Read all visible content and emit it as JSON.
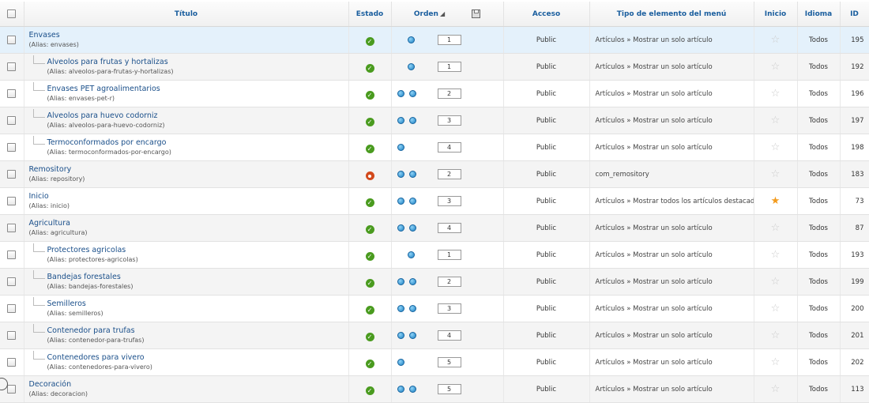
{
  "header": {
    "title": "Título",
    "estado": "Estado",
    "orden": "Orden",
    "acceso": "Acceso",
    "tipo": "Tipo de elemento del menú",
    "inicio": "Inicio",
    "idioma": "Idioma",
    "id": "ID"
  },
  "alias_prefix": "(Alias:",
  "colors": {
    "link": "#1a4f8a",
    "header_text": "#1a5e9e",
    "status_published": "#4a9b1f",
    "status_unpublished": "#d2491c",
    "home_star": "#f39a1c",
    "active_row": "#e4f1fb"
  },
  "rows": [
    {
      "title": "Envases",
      "alias": "(Alias: envases)",
      "level": 1,
      "status": "published",
      "arrows": "down",
      "order": "1",
      "access": "Public",
      "type": "Artículos » Mostrar un solo artículo",
      "home": false,
      "lang": "Todos",
      "id": "195"
    },
    {
      "title": "Alveolos para frutas y hortalizas",
      "alias": "(Alias: alveolos-para-frutas-y-hortalizas)",
      "level": 2,
      "status": "published",
      "arrows": "down",
      "order": "1",
      "access": "Public",
      "type": "Artículos » Mostrar un solo artículo",
      "home": false,
      "lang": "Todos",
      "id": "192"
    },
    {
      "title": "Envases PET agroalimentarios",
      "alias": "(Alias: envases-pet-r)",
      "level": 2,
      "status": "published",
      "arrows": "both",
      "order": "2",
      "access": "Public",
      "type": "Artículos » Mostrar un solo artículo",
      "home": false,
      "lang": "Todos",
      "id": "196"
    },
    {
      "title": "Alveolos para huevo codorniz",
      "alias": "(Alias: alveolos-para-huevo-codorniz)",
      "level": 2,
      "status": "published",
      "arrows": "both",
      "order": "3",
      "access": "Public",
      "type": "Artículos » Mostrar un solo artículo",
      "home": false,
      "lang": "Todos",
      "id": "197"
    },
    {
      "title": "Termoconformados por encargo",
      "alias": "(Alias: termoconformados-por-encargo)",
      "level": 2,
      "status": "published",
      "arrows": "up",
      "order": "4",
      "access": "Public",
      "type": "Artículos » Mostrar un solo artículo",
      "home": false,
      "lang": "Todos",
      "id": "198"
    },
    {
      "title": "Remository",
      "alias": "(Alias: repository)",
      "level": 1,
      "status": "unpublished",
      "arrows": "both",
      "order": "2",
      "access": "Public",
      "type": "com_remository",
      "home": false,
      "lang": "Todos",
      "id": "183"
    },
    {
      "title": "Inicio",
      "alias": "(Alias: inicio)",
      "level": 1,
      "status": "published",
      "arrows": "both",
      "order": "3",
      "access": "Public",
      "type": "Artículos » Mostrar todos los artículos destacados",
      "home": true,
      "lang": "Todos",
      "id": "73"
    },
    {
      "title": "Agricultura",
      "alias": "(Alias: agricultura)",
      "level": 1,
      "status": "published",
      "arrows": "both",
      "order": "4",
      "access": "Public",
      "type": "Artículos » Mostrar un solo artículo",
      "home": false,
      "lang": "Todos",
      "id": "87"
    },
    {
      "title": "Protectores agricolas",
      "alias": "(Alias: protectores-agricolas)",
      "level": 2,
      "status": "published",
      "arrows": "down",
      "order": "1",
      "access": "Public",
      "type": "Artículos » Mostrar un solo artículo",
      "home": false,
      "lang": "Todos",
      "id": "193"
    },
    {
      "title": "Bandejas forestales",
      "alias": "(Alias: bandejas-forestales)",
      "level": 2,
      "status": "published",
      "arrows": "both",
      "order": "2",
      "access": "Public",
      "type": "Artículos » Mostrar un solo artículo",
      "home": false,
      "lang": "Todos",
      "id": "199"
    },
    {
      "title": "Semilleros",
      "alias": "(Alias: semilleros)",
      "level": 2,
      "status": "published",
      "arrows": "both",
      "order": "3",
      "access": "Public",
      "type": "Artículos » Mostrar un solo artículo",
      "home": false,
      "lang": "Todos",
      "id": "200"
    },
    {
      "title": "Contenedor para trufas",
      "alias": "(Alias: contenedor-para-trufas)",
      "level": 2,
      "status": "published",
      "arrows": "both",
      "order": "4",
      "access": "Public",
      "type": "Artículos » Mostrar un solo artículo",
      "home": false,
      "lang": "Todos",
      "id": "201"
    },
    {
      "title": "Contenedores para vivero",
      "alias": "(Alias: contenedores-para-vivero)",
      "level": 2,
      "status": "published",
      "arrows": "up",
      "order": "5",
      "access": "Public",
      "type": "Artículos » Mostrar un solo artículo",
      "home": false,
      "lang": "Todos",
      "id": "202"
    },
    {
      "title": "Decoración",
      "alias": "(Alias: decoracion)",
      "level": 1,
      "status": "published",
      "arrows": "both",
      "order": "5",
      "access": "Public",
      "type": "Artículos » Mostrar un solo artículo",
      "home": false,
      "lang": "Todos",
      "id": "113"
    }
  ]
}
